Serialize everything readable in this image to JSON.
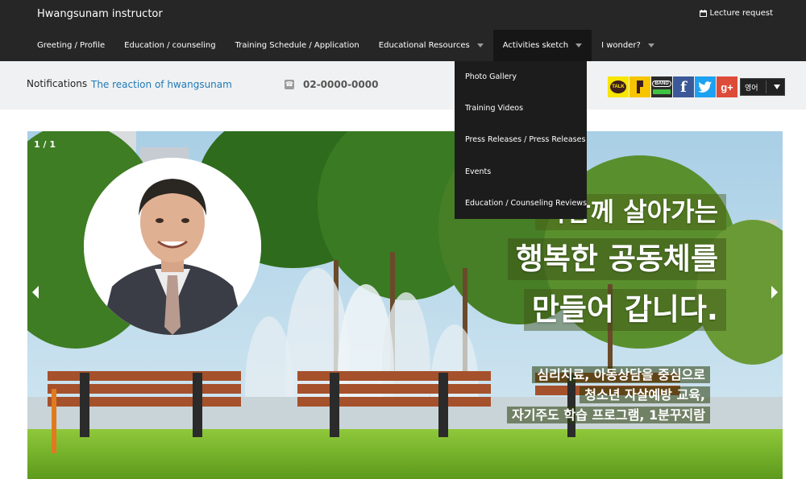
{
  "header": {
    "brand": "Hwangsunam instructor",
    "lecture_request": "Lecture request",
    "nav": [
      {
        "label": "Greeting / Profile"
      },
      {
        "label": "Education / counseling"
      },
      {
        "label": "Training Schedule / Application"
      },
      {
        "label": "Educational Resources"
      },
      {
        "label": "Activities sketch"
      },
      {
        "label": "I wonder?"
      }
    ]
  },
  "dropdown": {
    "items": [
      "Photo Gallery",
      "Training Videos",
      "Press Releases / Press Releases",
      "Events",
      "Education / Counseling Reviews"
    ]
  },
  "infobar": {
    "notifications_label": "Notifications",
    "notification_link": "The reaction of hwangsunam",
    "phone": "02-0000-0000",
    "social": [
      "TALK",
      "",
      "BAND",
      "f",
      "",
      "g+"
    ],
    "language": "영어"
  },
  "slider": {
    "counter": "1 / 1",
    "headline": [
      "다함께 살아가는",
      "행복한 공동체를",
      "만들어 갑니다."
    ],
    "subtext": [
      "심리치료, 아동상담을 중심으로",
      "청소년 자살예방 교육,",
      "자기주도 학습 프로그램, 1분꾸지람"
    ]
  },
  "colors": {
    "header_bg": "#262626",
    "active_nav_bg": "#161616",
    "infobar_bg": "#f0f1f2",
    "link": "#1f7ab8",
    "kakao": "#f7e600",
    "facebook": "#3b5998",
    "twitter": "#1da1f2",
    "google_plus": "#dd4b39"
  }
}
